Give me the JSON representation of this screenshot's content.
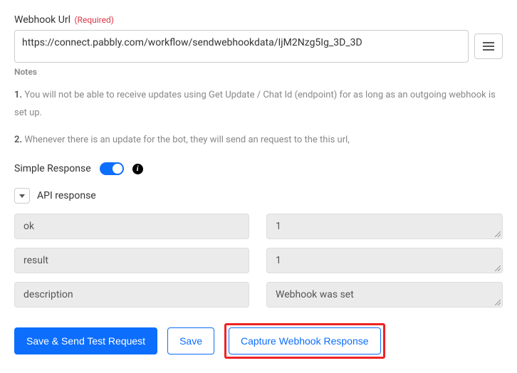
{
  "field": {
    "label": "Webhook Url",
    "required_tag": "(Required)",
    "value": "https://connect.pabbly.com/workflow/sendwebhookdata/IjM2Nzg5Ig_3D_3D"
  },
  "notes": {
    "heading": "Notes",
    "items": [
      {
        "num": "1.",
        "text": "You will not be able to receive updates using Get Update / Chat Id (endpoint) for as long as an outgoing webhook is set up."
      },
      {
        "num": "2.",
        "text": "Whenever there is an update for the bot, they will send an request to the this url,"
      }
    ]
  },
  "simple_response": {
    "label": "Simple Response",
    "on": true
  },
  "api_response": {
    "label": "API response",
    "rows": [
      {
        "key": "ok",
        "value": "1"
      },
      {
        "key": "result",
        "value": "1"
      },
      {
        "key": "description",
        "value": "Webhook was set"
      }
    ]
  },
  "buttons": {
    "save_send": "Save & Send Test Request",
    "save": "Save",
    "capture": "Capture Webhook Response"
  }
}
